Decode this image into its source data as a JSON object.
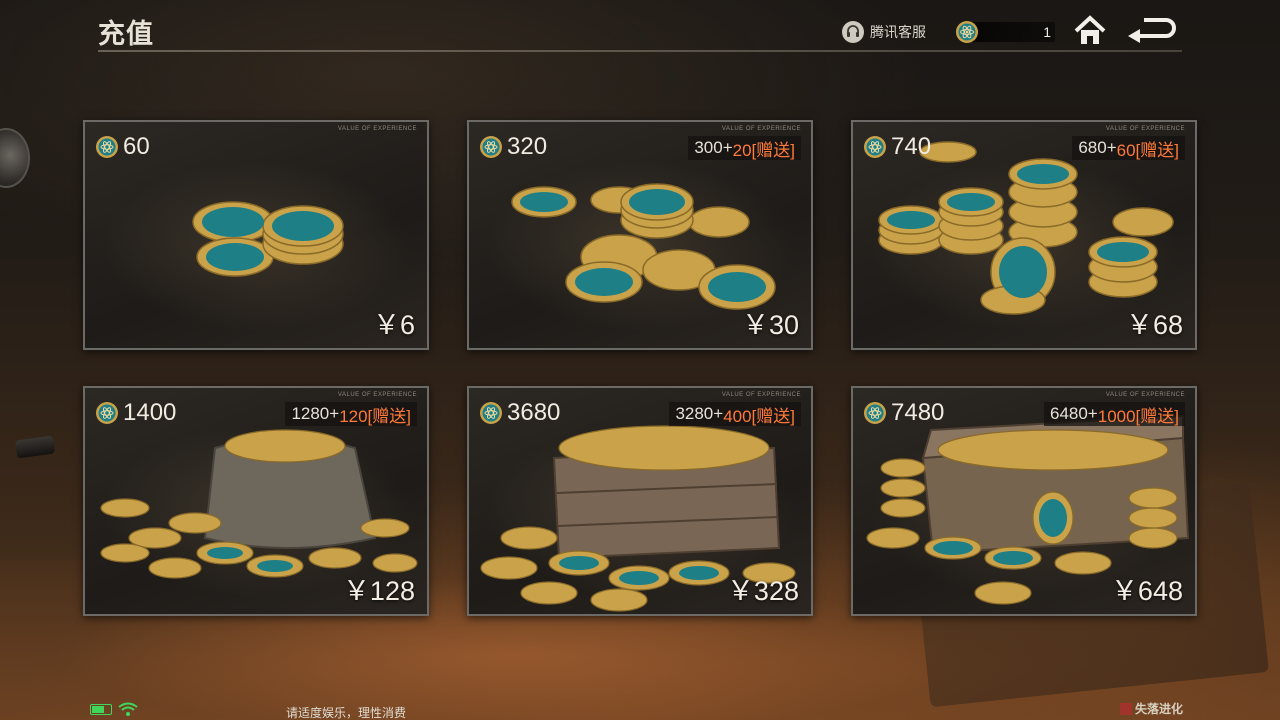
{
  "header": {
    "title": "充值",
    "customer_service_label": "腾讯客服",
    "currency_value": "1"
  },
  "packages": [
    {
      "amount": "60",
      "bonus_base": "",
      "bonus_extra": "",
      "price": "￥6"
    },
    {
      "amount": "320",
      "bonus_base": "300+",
      "bonus_extra": "20[赠送]",
      "price": "￥30"
    },
    {
      "amount": "740",
      "bonus_base": "680+",
      "bonus_extra": "60[赠送]",
      "price": "￥68"
    },
    {
      "amount": "1400",
      "bonus_base": "1280+",
      "bonus_extra": "120[赠送]",
      "price": "￥128"
    },
    {
      "amount": "3680",
      "bonus_base": "3280+",
      "bonus_extra": "400[赠送]",
      "price": "￥328"
    },
    {
      "amount": "7480",
      "bonus_base": "6480+",
      "bonus_extra": "1000[赠送]",
      "price": "￥648"
    }
  ],
  "card_tag": "VALUE OF EXPERIENCE",
  "footer": {
    "note": "请适度娱乐，理性消费",
    "logo_text": "失落进化",
    "battery_level": 0.7
  },
  "icons": {
    "currency": "atom-coin-icon",
    "customer_service": "headset-icon",
    "home": "home-icon",
    "back": "back-arrow-icon",
    "wifi": "wifi-icon",
    "battery": "battery-icon"
  },
  "colors": {
    "bonus_accent": "#ff7a3a",
    "status_green": "#3fd65a",
    "coin_teal": "#1e7f86",
    "coin_gold": "#c9a24a"
  }
}
